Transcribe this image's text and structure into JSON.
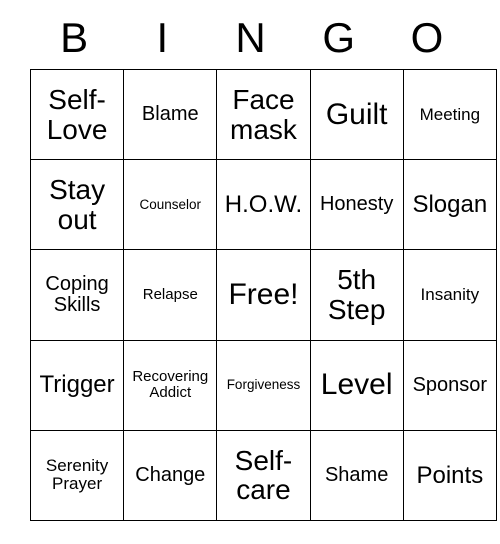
{
  "card": {
    "header_letters": [
      "B",
      "I",
      "N",
      "G",
      "O"
    ],
    "rows": [
      [
        {
          "text": "Self-Love",
          "size": "fs-lg"
        },
        {
          "text": "Blame",
          "size": "fs-sm"
        },
        {
          "text": "Face mask",
          "size": "fs-lg"
        },
        {
          "text": "Guilt",
          "size": "fs-xl"
        },
        {
          "text": "Meeting",
          "size": "fs-xs"
        }
      ],
      [
        {
          "text": "Stay out",
          "size": "fs-lg"
        },
        {
          "text": "Counselor",
          "size": "fs-tiny"
        },
        {
          "text": "H.O.W.",
          "size": "fs-md"
        },
        {
          "text": "Honesty",
          "size": "fs-sm"
        },
        {
          "text": "Slogan",
          "size": "fs-md"
        }
      ],
      [
        {
          "text": "Coping Skills",
          "size": "fs-sm"
        },
        {
          "text": "Relapse",
          "size": "fs-xxs"
        },
        {
          "text": "Free!",
          "size": "fs-xl"
        },
        {
          "text": "5th Step",
          "size": "fs-lg"
        },
        {
          "text": "Insanity",
          "size": "fs-xs"
        }
      ],
      [
        {
          "text": "Trigger",
          "size": "fs-md"
        },
        {
          "text": "Recovering Addict",
          "size": "fs-xxs"
        },
        {
          "text": "Forgiveness",
          "size": "fs-tiny"
        },
        {
          "text": "Level",
          "size": "fs-xl"
        },
        {
          "text": "Sponsor",
          "size": "fs-sm"
        }
      ],
      [
        {
          "text": "Serenity Prayer",
          "size": "fs-xs"
        },
        {
          "text": "Change",
          "size": "fs-sm"
        },
        {
          "text": "Self-care",
          "size": "fs-lg"
        },
        {
          "text": "Shame",
          "size": "fs-sm"
        },
        {
          "text": "Points",
          "size": "fs-md"
        }
      ]
    ],
    "free_space": {
      "row": 2,
      "col": 2,
      "label": "Free!"
    },
    "colors": {
      "background": "#ffffff",
      "text": "#000000",
      "border": "#000000"
    }
  }
}
